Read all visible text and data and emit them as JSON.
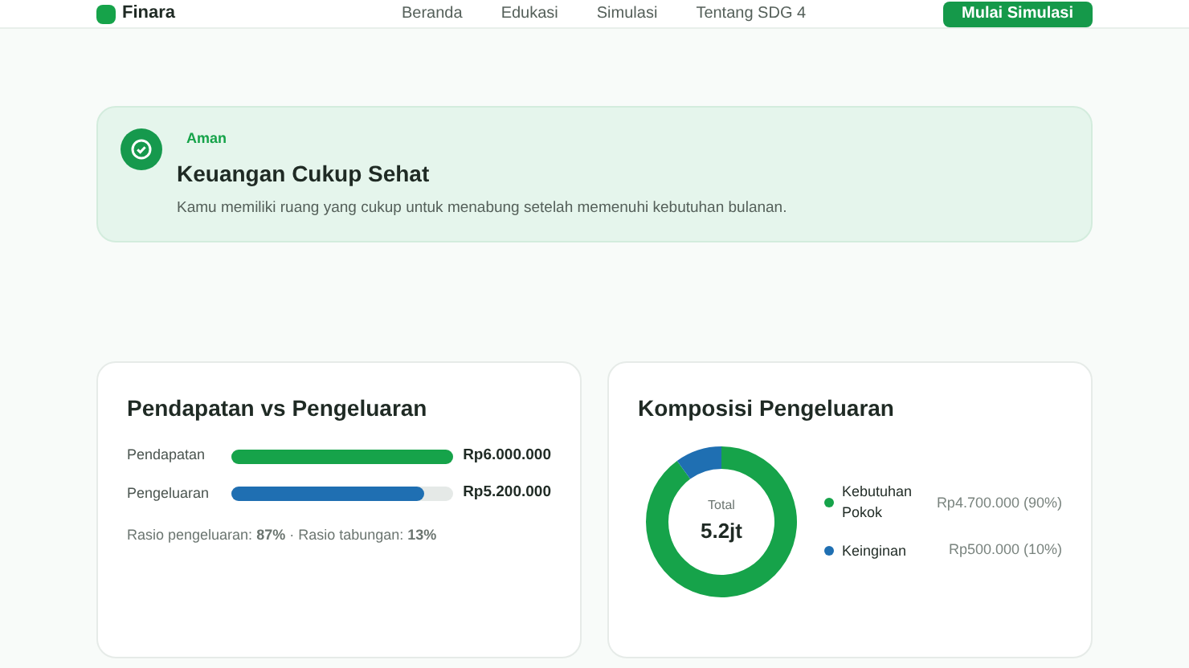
{
  "nav": {
    "brand": "Finara",
    "links": [
      {
        "label": "Beranda",
        "selected": false
      },
      {
        "label": "Edukasi",
        "selected": false
      },
      {
        "label": "Simulasi",
        "selected": false
      },
      {
        "label": "Tentang SDG 4",
        "selected": false
      }
    ],
    "cta": "Mulai Simulasi"
  },
  "status": {
    "badge": "Aman",
    "title": "Keuangan Cukup Sehat",
    "message": "Kamu memiliki ruang yang cukup untuk menabung setelah memenuhi kebutuhan bulanan."
  },
  "income_vs_expense": {
    "title": "Pendapatan vs Pengeluaran",
    "bars": [
      {
        "label": "Pendapatan",
        "level": 1,
        "amount": "Rp6.000.000",
        "color": "#16a34a"
      },
      {
        "label": "Pengeluaran",
        "level": 0.87,
        "amount": "Rp5.200.000",
        "color": "#1f6fb2"
      }
    ],
    "ratio": "Rasio pengeluaran: **87%** · Rasio tabungan: **13%**"
  },
  "composition": {
    "title": "Komposisi Pengeluaran",
    "center_label": "Total",
    "center_value": "5.2jt",
    "legend": [
      {
        "amount": "Rp4.700.000 (90%)",
        "color": "#16a34a"
      },
      {
        "amount": "Rp500.000 (10%)",
        "color": "#1f6fb2"
      }
    ],
    "chart_data": {
      "type": "donut",
      "categories": [
        "Kebutuhan Pokok",
        "Keinginan"
      ],
      "values": [
        90,
        10
      ]
    }
  }
}
